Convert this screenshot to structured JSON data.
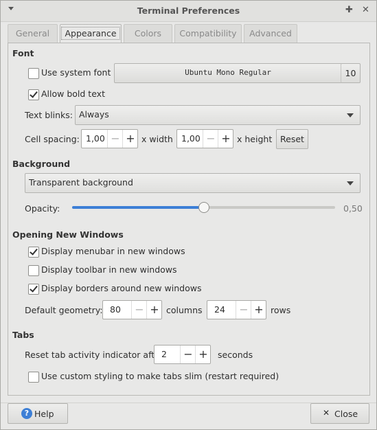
{
  "window": {
    "title": "Terminal Preferences",
    "pin_glyph": "✚",
    "close_glyph": "✕"
  },
  "tabs": [
    "General",
    "Appearance",
    "Colors",
    "Compatibility",
    "Advanced"
  ],
  "font": {
    "heading": "Font",
    "use_system_font": "Use system font",
    "font_name": "Ubuntu Mono Regular",
    "font_size": "10",
    "allow_bold": "Allow bold text",
    "text_blinks_label": "Text blinks:",
    "text_blinks_value": "Always",
    "cell_spacing_label": "Cell spacing:",
    "width_value": "1,00",
    "width_label": "x width",
    "height_value": "1,00",
    "height_label": "x height",
    "reset": "Reset"
  },
  "background": {
    "heading": "Background",
    "value": "Transparent background",
    "opacity_label": "Opacity:",
    "opacity_value": "0,50",
    "opacity_fraction": 0.5
  },
  "windows": {
    "heading": "Opening New Windows",
    "menubar": "Display menubar in new windows",
    "toolbar": "Display toolbar in new windows",
    "borders": "Display borders around new windows",
    "geometry_label": "Default geometry:",
    "columns_value": "80",
    "columns_label": "columns",
    "rows_value": "24",
    "rows_label": "rows"
  },
  "tabs_section": {
    "heading": "Tabs",
    "reset_label": "Reset tab activity indicator after",
    "reset_value": "2",
    "seconds": "seconds",
    "slim": "Use custom styling to make tabs slim (restart required)"
  },
  "footer": {
    "help": "Help",
    "close": "Close"
  },
  "spin_minus": "−",
  "spin_plus": "+",
  "colors": {
    "accent": "#3d7fd6"
  }
}
